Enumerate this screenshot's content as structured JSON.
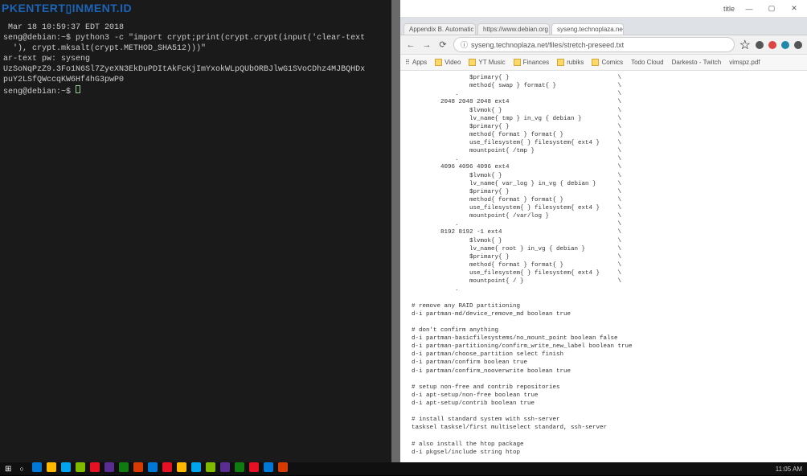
{
  "logo": "PKENTERT▯INMENT.ID",
  "terminal": {
    "line1": " Mar 18 10:59:37 EDT 2018",
    "line2_prompt": "seng@debian:~$",
    "line2_cmd": " python3 -c \"import crypt;print(crypt.crypt(input('clear-text",
    "line3": "  '), crypt.mksalt(crypt.METHOD_SHA512)))\"",
    "line4": "ar-text pw: syseng",
    "line5": "UzSoNqPzZ9.3Fo1N6Sl7ZyeXN3EkDuPDItAkFcKjImYxokWLpQUbORBJlwG1SVoCDhz4MJBQHDx",
    "line6": "puY2LSfQWccqKW6Hf4hG3pwP0",
    "line7_prompt": "seng@debian:~$"
  },
  "browser": {
    "window": {
      "title": "title",
      "min": "—",
      "max": "▢",
      "close": "✕"
    },
    "tabs": [
      {
        "label": "Appendix B. Automatic",
        "close": "×"
      },
      {
        "label": "https://www.debian.org",
        "close": "×"
      },
      {
        "label": "syseng.technoplaza.ne",
        "close": "×"
      }
    ],
    "nav": {
      "back": "←",
      "forward": "→",
      "reload": "⟳",
      "secure": "ⓘ"
    },
    "url": "syseng.technoplaza.net/files/stretch-preseed.txt",
    "star": "☆",
    "ext_colors": [
      "#555",
      "#d44",
      "#28a",
      "#555"
    ],
    "bookmarks": [
      {
        "label": "Apps",
        "folder": false
      },
      {
        "label": "Video",
        "folder": true
      },
      {
        "label": "YT Music",
        "folder": true
      },
      {
        "label": "Finances",
        "folder": true
      },
      {
        "label": "rubiks",
        "folder": true
      },
      {
        "label": "Comics",
        "folder": true
      },
      {
        "label": "Todo Cloud",
        "folder": false
      },
      {
        "label": "Darkesto - Twitch",
        "folder": false
      },
      {
        "label": "vimspz.pdf",
        "folder": false
      }
    ],
    "content": "                $primary{ }                              \\\n                method{ swap } format{ }                 \\\n            .                                            \\\n        2048 2048 2048 ext4                              \\\n                $lvmok{ }                                \\\n                lv_name{ tmp } in_vg { debian }          \\\n                $primary{ }                              \\\n                method{ format } format{ }               \\\n                use_filesystem{ } filesystem{ ext4 }     \\\n                mountpoint{ /tmp }                       \\\n            .                                            \\\n        4096 4096 4096 ext4                              \\\n                $lvmok{ }                                \\\n                lv_name{ var_log } in_vg { debian }      \\\n                $primary{ }                              \\\n                method{ format } format{ }               \\\n                use_filesystem{ } filesystem{ ext4 }     \\\n                mountpoint{ /var/log }                   \\\n            .                                            \\\n        8192 8192 -1 ext4                                \\\n                $lvmok{ }                                \\\n                lv_name{ root } in_vg { debian }         \\\n                $primary{ }                              \\\n                method{ format } format{ }               \\\n                use_filesystem{ } filesystem{ ext4 }     \\\n                mountpoint{ / }                          \\\n            .\n\n# remove any RAID partitioning\nd-i partman-md/device_remove_md boolean true\n\n# don't confirm anything\nd-i partman-basicfilesystems/no_mount_point boolean false\nd-i partman-partitioning/confirm_write_new_label boolean true\nd-i partman/choose_partition select finish\nd-i partman/confirm boolean true\nd-i partman/confirm_nooverwrite boolean true\n\n# setup non-free and contrib repositories\nd-i apt-setup/non-free boolean true\nd-i apt-setup/contrib boolean true\n\n# install standard system with ssh-server\ntasksel tasksel/first multiselect standard, ssh-server\n\n# also install the htop package\nd-i pkgsel/include string htop\n\n# upgrade all packages\nd-i pkgsel/upgrade select full-upgrade\n\n# disable popularity contest\npopularity-contest popularity-contest/participate boolean false\n\n# force grub install to /dev/sda\nd-i grub-installer/only_debian boolean true\nd-i grub-installer/with_other_os boolean true\nd-i grub-installer/bootdev  string /dev/sda\n\n# don't wait for confirm, just reboot when finished\nd-i finish-install/reboot_in_progress note"
  },
  "taskbar": {
    "icons": [
      "#0078d7",
      "#ffb900",
      "#00a4ef",
      "#7fba00",
      "#e81123",
      "#5c2d91",
      "#107c10",
      "#d83b01",
      "#0078d7",
      "#e81123",
      "#ffb900",
      "#00a4ef",
      "#7fba00",
      "#5c2d91",
      "#107c10",
      "#e81123",
      "#0078d7",
      "#d83b01"
    ],
    "time": "11:05 AM"
  }
}
